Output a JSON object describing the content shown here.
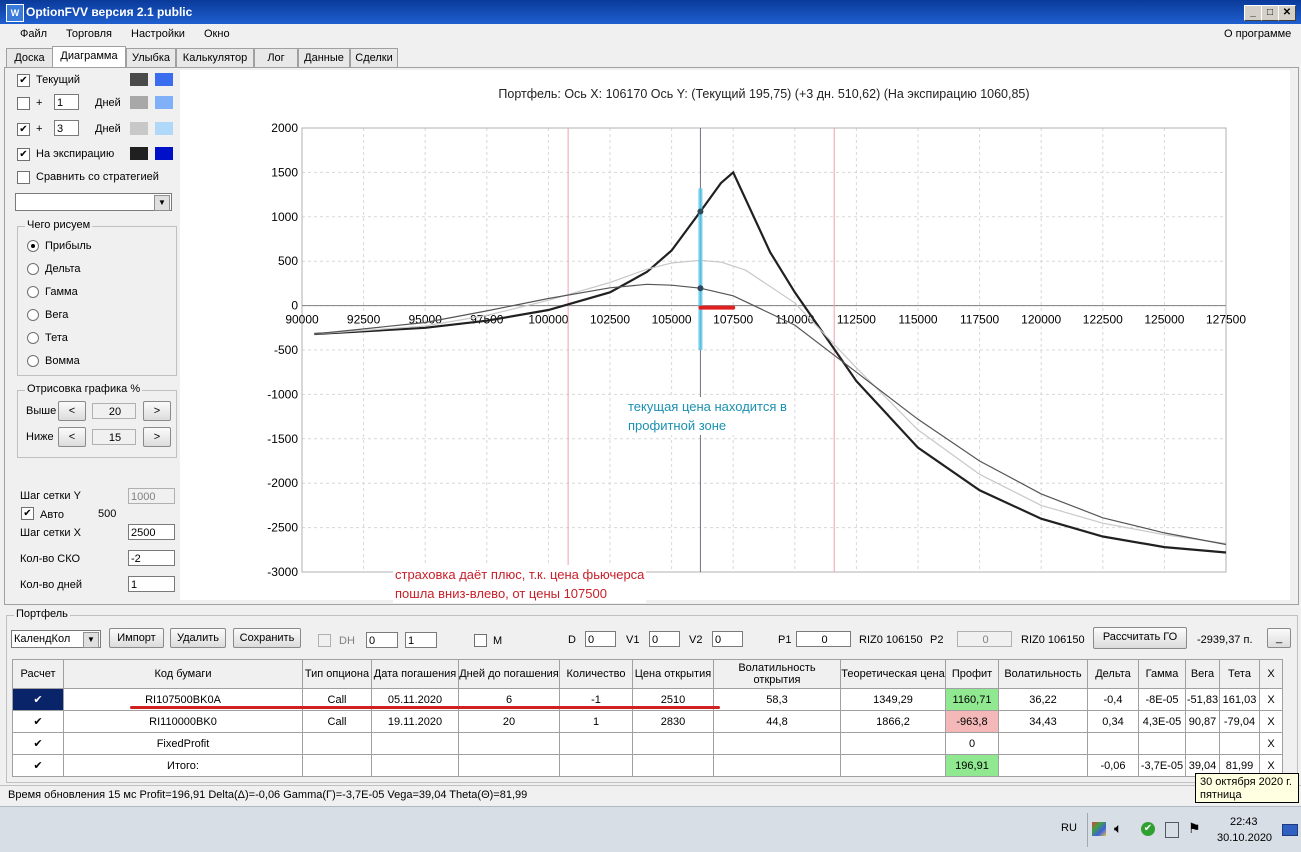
{
  "window": {
    "title": "OptionFVV версия 2.1 public"
  },
  "menu": {
    "items": [
      "Файл",
      "Торговля",
      "Настройки",
      "Окно"
    ],
    "about": "О программе"
  },
  "tabs": [
    "Доска",
    "Диаграмма",
    "Улыбка",
    "Калькулятор",
    "Лог",
    "Данные",
    "Сделки"
  ],
  "left": {
    "current_label": "Текущий",
    "plus": "+",
    "days_label": "Дней",
    "days1": "1",
    "days2": "3",
    "expiry_label": "На экспирацию",
    "compare_label": "Сравнить со стратегией",
    "what_group": "Чего рисуем",
    "radios": [
      "Прибыль",
      "Дельта",
      "Гамма",
      "Вега",
      "Тета",
      "Вомма"
    ],
    "draw_group": "Отрисовка графика %",
    "above_label": "Выше",
    "above_value": "20",
    "below_label": "Ниже",
    "below_value": "15",
    "left_arrow": "<",
    "right_arrow": ">",
    "grid_y_label": "Шаг сетки Y",
    "grid_y_value": "1000",
    "auto_label": "Авто",
    "auto_value": "500",
    "grid_x_label": "Шаг сетки X",
    "grid_x_value": "2500",
    "sko_label": "Кол-во СКО",
    "sko_value": "-2",
    "days_count_label": "Кол-во дней",
    "days_count_value": "1",
    "colors": {
      "current": [
        "#4a4a4a",
        "#3a6cf0"
      ],
      "d1": [
        "#a8a8a8",
        "#80b0f8"
      ],
      "d3": [
        "#c8c8c8",
        "#b0d8f8"
      ],
      "exp": [
        "#202020",
        "#0010c8"
      ]
    }
  },
  "chart_data": {
    "type": "line",
    "title": "Портфель: Ось X: 106170 Ось Y:  (Текущий 195,75)  (+3 дн. 510,62)  (На экспирацию 1060,85)",
    "xlim": [
      90000,
      127500
    ],
    "ylim": [
      -3000,
      2000
    ],
    "x_ticks": [
      90000,
      92500,
      95000,
      97500,
      100000,
      102500,
      105000,
      107500,
      110000,
      112500,
      115000,
      117500,
      120000,
      122500,
      125000,
      127500
    ],
    "y_ticks": [
      2000,
      1500,
      1000,
      500,
      0,
      -500,
      -1000,
      -1500,
      -2000,
      -2500,
      -3000
    ],
    "current_price": 106170,
    "range_lines": [
      100800,
      111600
    ],
    "series": [
      {
        "color": "#202020",
        "width": 2.2,
        "x": [
          90500,
          95000,
          97500,
          100000,
          102500,
          104000,
          105000,
          106170,
          107000,
          107500,
          109000,
          110000,
          112500,
          115000,
          117500,
          120000,
          122500,
          125000,
          127500
        ],
        "y": [
          -320,
          -250,
          -170,
          -50,
          150,
          380,
          620,
          1060,
          1380,
          1500,
          600,
          150,
          -850,
          -1600,
          -2080,
          -2400,
          -2600,
          -2720,
          -2780
        ]
      },
      {
        "color": "#c8c8c8",
        "width": 1.2,
        "x": [
          90500,
          95000,
          97500,
          100000,
          102500,
          104000,
          105000,
          106170,
          107000,
          108000,
          110000,
          112500,
          115000,
          117500,
          120000,
          122500,
          125000,
          127500
        ],
        "y": [
          -320,
          -230,
          -110,
          60,
          260,
          410,
          480,
          510,
          490,
          400,
          30,
          -700,
          -1400,
          -1900,
          -2250,
          -2450,
          -2580,
          -2680
        ]
      },
      {
        "color": "#555555",
        "width": 1.2,
        "x": [
          90500,
          95000,
          97500,
          100000,
          102500,
          104000,
          105000,
          106170,
          107500,
          110000,
          112500,
          115000,
          117500,
          120000,
          122500,
          125000,
          127500
        ],
        "y": [
          -320,
          -190,
          -60,
          80,
          200,
          240,
          230,
          196,
          110,
          -220,
          -750,
          -1280,
          -1750,
          -2120,
          -2390,
          -2560,
          -2690
        ]
      }
    ],
    "annotations": [
      {
        "text": [
          "текущая цена находится в",
          "профитной зоне"
        ],
        "color": "#1a90b0"
      },
      {
        "text": [
          "страховка даёт плюс, т.к. цена фьючерса",
          "пошла вниз-влево, от цены 107500"
        ],
        "color": "#c8202a"
      }
    ]
  },
  "portfolio": {
    "group_label": "Портфель",
    "combo": "КалендКол",
    "import_btn": "Импорт",
    "delete_btn": "Удалить",
    "save_btn": "Сохранить",
    "dh_label": "DH",
    "dh_v1": "0",
    "dh_v2": "1",
    "m_label": "M",
    "d_label": "D",
    "d_value": "0",
    "v1_label": "V1",
    "v1_value": "0",
    "v2_label": "V2",
    "v2_value": "0",
    "p1_label": "P1",
    "p1_value": "0",
    "riz_label1": "RIZ0 106150",
    "p2_label": "P2",
    "p2_value": "0",
    "riz_label2": "RIZ0 106150",
    "calc_btn": "Рассчитать ГО",
    "go_value": "-2939,37 п.",
    "small_btn": "_"
  },
  "table": {
    "headers": [
      "Расчет",
      "Код бумаги",
      "Тип опциона",
      "Дата погашения",
      "Дней до погашения",
      "Количество",
      "Цена открытия",
      "Волатильность открытия",
      "Теоретическая цена",
      "Профит",
      "Волатильность",
      "Дельта",
      "Гамма",
      "Вега",
      "Тета",
      "X"
    ],
    "rows": [
      {
        "check": "✔",
        "code": "RI107500BK0A",
        "type": "Call",
        "date": "05.11.2020",
        "days": "6",
        "qty": "-1",
        "price": "2510",
        "vol_open": "58,3",
        "theo": "1349,29",
        "profit": "1160,71",
        "vol": "36,22",
        "delta": "-0,4",
        "gamma": "-8E-05",
        "vega": "-51,83",
        "theta": "161,03",
        "x": "X"
      },
      {
        "check": "✔",
        "code": "RI110000BK0",
        "type": "Call",
        "date": "19.11.2020",
        "days": "20",
        "qty": "1",
        "price": "2830",
        "vol_open": "44,8",
        "theo": "1866,2",
        "profit": "-963,8",
        "vol": "34,43",
        "delta": "0,34",
        "gamma": "4,3E-05",
        "vega": "90,87",
        "theta": "-79,04",
        "x": "X"
      },
      {
        "check": "✔",
        "code": "FixedProfit",
        "type": "",
        "date": "",
        "days": "",
        "qty": "",
        "price": "",
        "vol_open": "",
        "theo": "",
        "profit": "0",
        "vol": "",
        "delta": "",
        "gamma": "",
        "vega": "",
        "theta": "",
        "x": "X"
      },
      {
        "check": "✔",
        "code": "Итого:",
        "type": "",
        "date": "",
        "days": "",
        "qty": "",
        "price": "",
        "vol_open": "",
        "theo": "",
        "profit": "196,91",
        "vol": "",
        "delta": "-0,06",
        "gamma": "-3,7E-05",
        "vega": "39,04",
        "theta": "81,99",
        "x": "X"
      }
    ]
  },
  "status": {
    "text": "Время обновления 15 мс  Profit=196,91 Delta(Δ)=-0,06 Gamma(Γ)=-3,7E-05 Vega=39,04 Theta(Θ)=81,99"
  },
  "tooltip": {
    "line1": "30 октября 2020 г.",
    "line2": "пятница"
  },
  "taskbar": {
    "lang": "RU",
    "time": "22:43",
    "date": "30.10.2020"
  }
}
